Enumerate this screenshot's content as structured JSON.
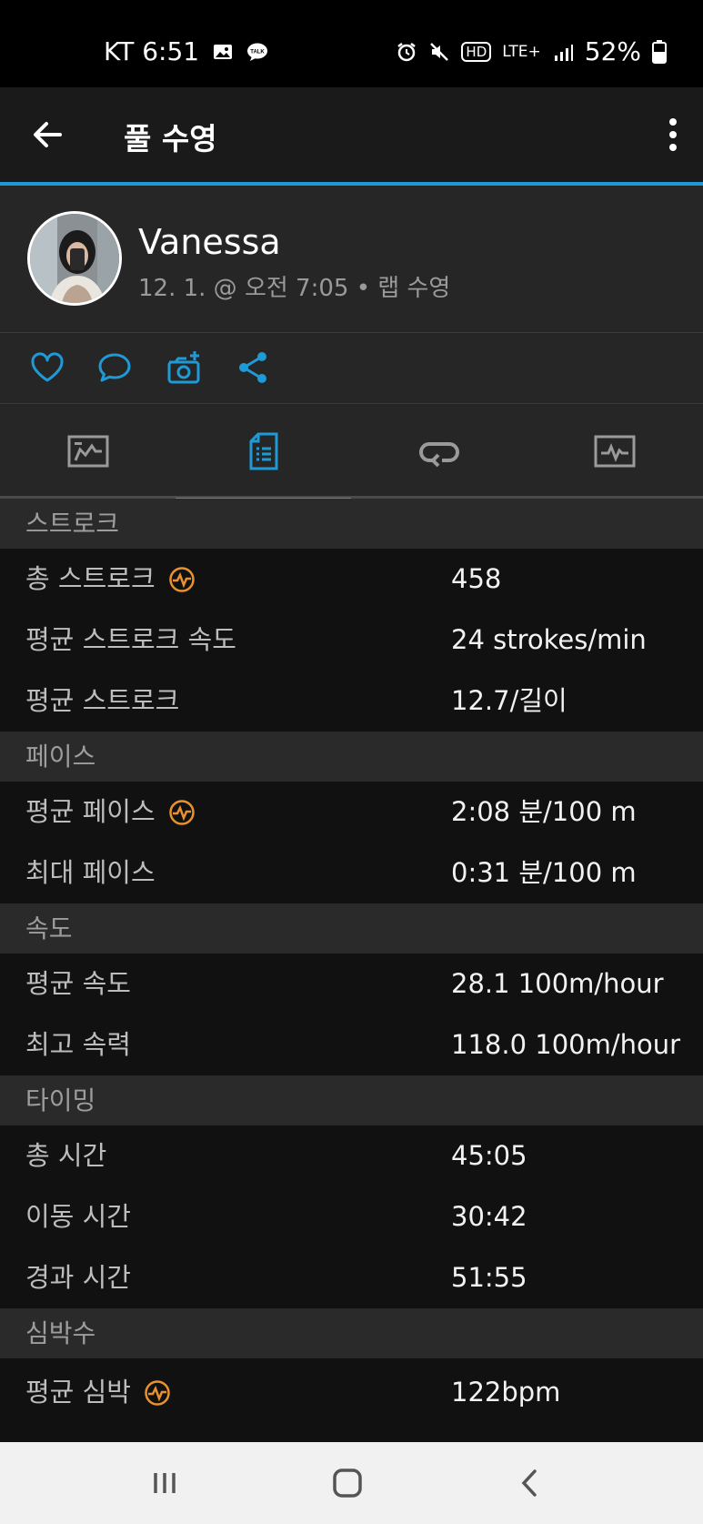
{
  "status_bar": {
    "carrier_time": "KT 6:51",
    "talk_badge": "TALK",
    "hd": "HD",
    "network": "LTE+",
    "battery": "52%"
  },
  "app_bar": {
    "title": "풀 수영"
  },
  "profile": {
    "name": "Vanessa",
    "subtitle": "12. 1. @ 오전 7:05 • 랩 수영"
  },
  "colors": {
    "accent": "#1e9bd7",
    "orange": "#e8922e"
  },
  "sections": {
    "stroke": {
      "title": "스트로크",
      "rows": [
        {
          "label": "총 스트로크",
          "value": "458"
        },
        {
          "label": "평균 스트로크 속도",
          "value": "24 strokes/min"
        },
        {
          "label": "평균 스트로크",
          "value": "12.7/길이"
        }
      ]
    },
    "pace": {
      "title": "페이스",
      "rows": [
        {
          "label": "평균 페이스",
          "value": "2:08 분/100 m"
        },
        {
          "label": "최대 페이스",
          "value": "0:31 분/100 m"
        }
      ]
    },
    "speed": {
      "title": "속도",
      "rows": [
        {
          "label": "평균 속도",
          "value": "28.1 100m/hour"
        },
        {
          "label": "최고 속력",
          "value": "118.0 100m/hour"
        }
      ]
    },
    "timing": {
      "title": "타이밍",
      "rows": [
        {
          "label": "총 시간",
          "value": "45:05"
        },
        {
          "label": "이동 시간",
          "value": "30:42"
        },
        {
          "label": "경과 시간",
          "value": "51:55"
        }
      ]
    },
    "heart": {
      "title": "심박수",
      "rows": [
        {
          "label": "평균 심박",
          "value": "122bpm"
        }
      ]
    }
  }
}
